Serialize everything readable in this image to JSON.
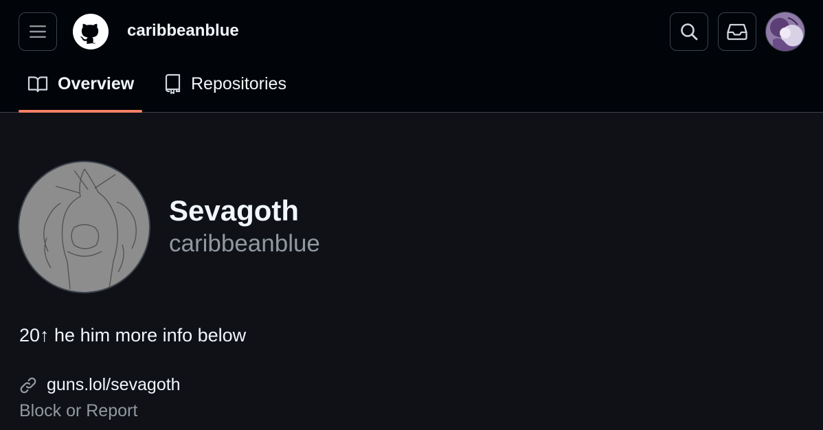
{
  "header": {
    "username": "caribbeanblue",
    "icons": {
      "menu": "hamburger-menu-icon",
      "logo": "github-mark-icon",
      "search": "search-icon",
      "inbox": "inbox-icon"
    }
  },
  "tabs": [
    {
      "label": "Overview",
      "icon": "book-icon",
      "selected": true
    },
    {
      "label": "Repositories",
      "icon": "repo-icon",
      "selected": false
    }
  ],
  "profile": {
    "display_name": "Sevagoth",
    "login": "caribbeanblue",
    "bio": "20↑ he him more info below",
    "website": "guns.lol/sevagoth",
    "block_report": "Block or Report"
  },
  "colors": {
    "header_bg": "#010409",
    "page_bg": "#0f1117",
    "tab_underline": "#f78166",
    "muted_text": "#9198a1",
    "border": "#3d444d"
  }
}
